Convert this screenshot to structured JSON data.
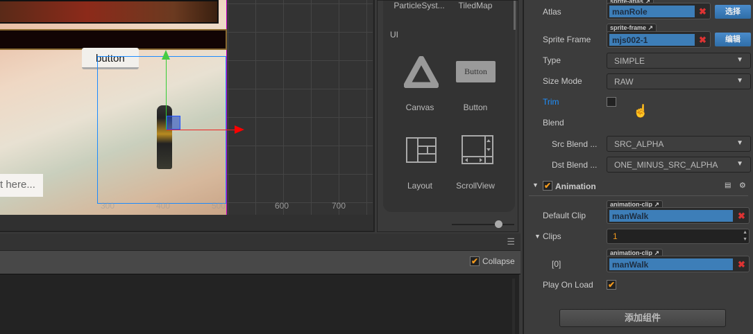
{
  "scene": {
    "button_node_label": "button",
    "input_node_placeholder": "t here...",
    "ruler_ticks": [
      "300",
      "400",
      "500",
      "600",
      "700"
    ]
  },
  "assets": {
    "items_top": [
      "ParticleSyst...",
      "TiledMap"
    ],
    "section_ui": "UI",
    "items": [
      {
        "label": "Canvas",
        "icon": "canvas-icon"
      },
      {
        "label": "Button",
        "icon": "button-icon",
        "icon_text": "Button"
      },
      {
        "label": "Layout",
        "icon": "layout-icon"
      },
      {
        "label": "ScrollView",
        "icon": "scrollview-icon"
      }
    ]
  },
  "console": {
    "collapse_label": "Collapse",
    "collapse_checked": true
  },
  "inspector": {
    "atlas": {
      "label": "Atlas",
      "tag": "sprite-atlas",
      "value": "manRole",
      "button": "选择"
    },
    "sprite_frame": {
      "label": "Sprite Frame",
      "tag": "sprite-frame",
      "value": "mjs002-1",
      "button": "编辑"
    },
    "type": {
      "label": "Type",
      "value": "SIMPLE"
    },
    "size_mode": {
      "label": "Size Mode",
      "value": "RAW"
    },
    "trim": {
      "label": "Trim",
      "checked": false
    },
    "blend": {
      "label": "Blend"
    },
    "src_blend": {
      "label": "Src Blend ...",
      "value": "SRC_ALPHA"
    },
    "dst_blend": {
      "label": "Dst Blend ...",
      "value": "ONE_MINUS_SRC_ALPHA"
    },
    "animation": {
      "title": "Animation",
      "enabled": true,
      "default_clip": {
        "label": "Default Clip",
        "tag": "animation-clip",
        "value": "manWalk"
      },
      "clips": {
        "label": "Clips",
        "count": "1"
      },
      "clip0": {
        "label": "[0]",
        "tag": "animation-clip",
        "value": "manWalk"
      },
      "play_on_load": {
        "label": "Play On Load",
        "checked": true
      }
    },
    "add_component": "添加组件"
  },
  "colors": {
    "accent": "#3d7eb8",
    "checkbox": "#f39a1d",
    "trim_label": "#1e90ff"
  }
}
